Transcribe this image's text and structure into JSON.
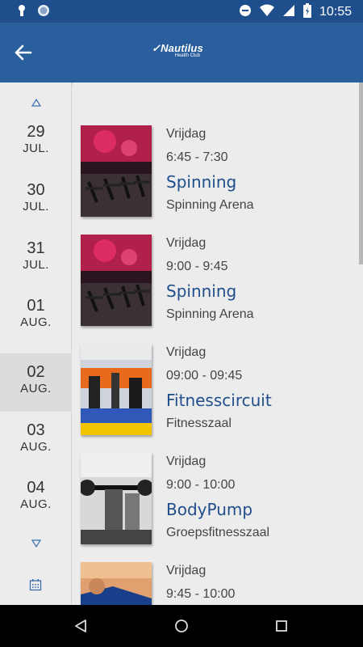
{
  "status_bar": {
    "time": "10:55"
  },
  "app_bar": {
    "logo_main": "Nautilus",
    "logo_sub": "Health Club"
  },
  "dates": [
    {
      "day": "29",
      "month": "JUL.",
      "selected": false
    },
    {
      "day": "30",
      "month": "JUL.",
      "selected": false
    },
    {
      "day": "31",
      "month": "JUL.",
      "selected": false
    },
    {
      "day": "01",
      "month": "AUG.",
      "selected": false
    },
    {
      "day": "02",
      "month": "AUG.",
      "selected": true
    },
    {
      "day": "03",
      "month": "AUG.",
      "selected": false
    },
    {
      "day": "04",
      "month": "AUG.",
      "selected": false
    }
  ],
  "classes": [
    {
      "day": "Vrijdag",
      "time": "6:45  -  7:30",
      "title": "Spinning",
      "location": "Spinning Arena",
      "thumb": "spinning"
    },
    {
      "day": "Vrijdag",
      "time": "9:00  -  9:45",
      "title": "Spinning",
      "location": "Spinning Arena",
      "thumb": "spinning"
    },
    {
      "day": "Vrijdag",
      "time": "09:00  -  09:45",
      "title": "Fitnesscircuit",
      "location": "Fitnesszaal",
      "thumb": "fitness"
    },
    {
      "day": "Vrijdag",
      "time": "9:00  -  10:00",
      "title": "BodyPump",
      "location": "Groepsfitnesszaal",
      "thumb": "bodypump"
    },
    {
      "day": "Vrijdag",
      "time": "9:45  -  10:00",
      "title": "",
      "location": "",
      "thumb": "stretch"
    }
  ],
  "colors": {
    "primary": "#2a5f9e",
    "status_bar": "#1f4e8c",
    "title": "#1f4e8c"
  }
}
